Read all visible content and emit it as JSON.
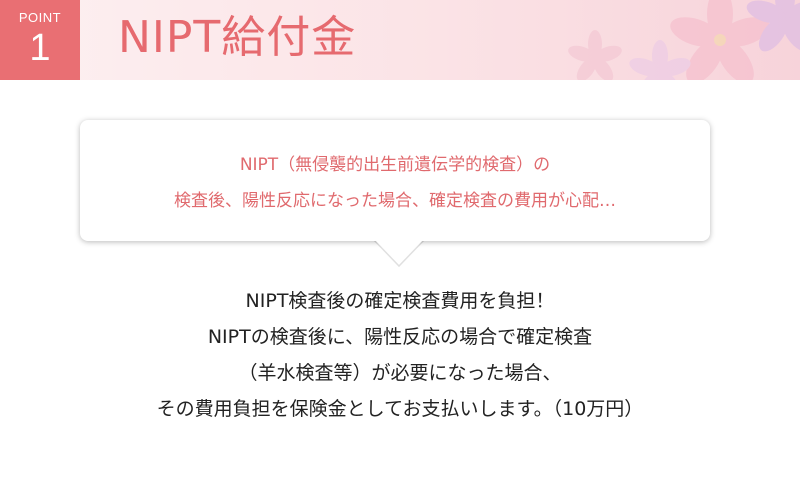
{
  "header": {
    "point_label": "POINT",
    "point_number": "1",
    "title": "NIPT給付金",
    "accent_color": "#e96f73",
    "decoration": "pink-flower-background"
  },
  "bubble": {
    "lines": [
      "NIPT（無侵襲的出生前遺伝学的検査）の",
      "検査後、陽性反応になった場合、確定検査の費用が心配…"
    ]
  },
  "main": {
    "lines": [
      "NIPT検査後の確定検査費用を負担！",
      "NIPTの検査後に、陽性反応の場合で確定検査",
      "（羊水検査等）が必要になった場合、",
      "その費用負担を保険金としてお支払いします。（10万円）"
    ]
  }
}
